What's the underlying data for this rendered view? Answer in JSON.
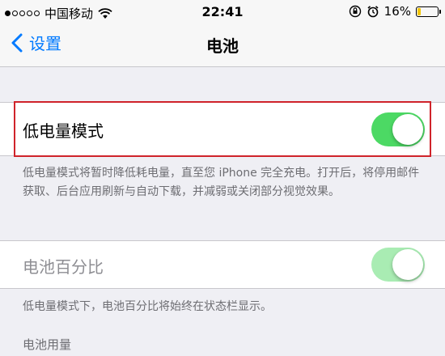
{
  "status_bar": {
    "carrier": "中国移动",
    "time": "22:41",
    "battery_percent": "16%",
    "battery_level": 0.16,
    "signal_strength": 3,
    "battery_fill_color": "#f2c500"
  },
  "nav": {
    "back_label": "设置",
    "title": "电池"
  },
  "low_power_mode": {
    "label": "低电量模式",
    "enabled": true,
    "description": "低电量模式将暂时降低耗电量，直至您 iPhone 完全充电。打开后，将停用邮件获取、后台应用刷新与自动下载，并减弱或关闭部分视觉效果。"
  },
  "battery_percentage": {
    "label": "电池百分比",
    "enabled": true,
    "disabled": true,
    "description": "低电量模式下，电池百分比将始终在状态栏显示。"
  },
  "battery_usage": {
    "header": "电池用量"
  },
  "colors": {
    "accent": "#007aff",
    "toggle_on": "#4cd964",
    "highlight": "#d0232a"
  }
}
